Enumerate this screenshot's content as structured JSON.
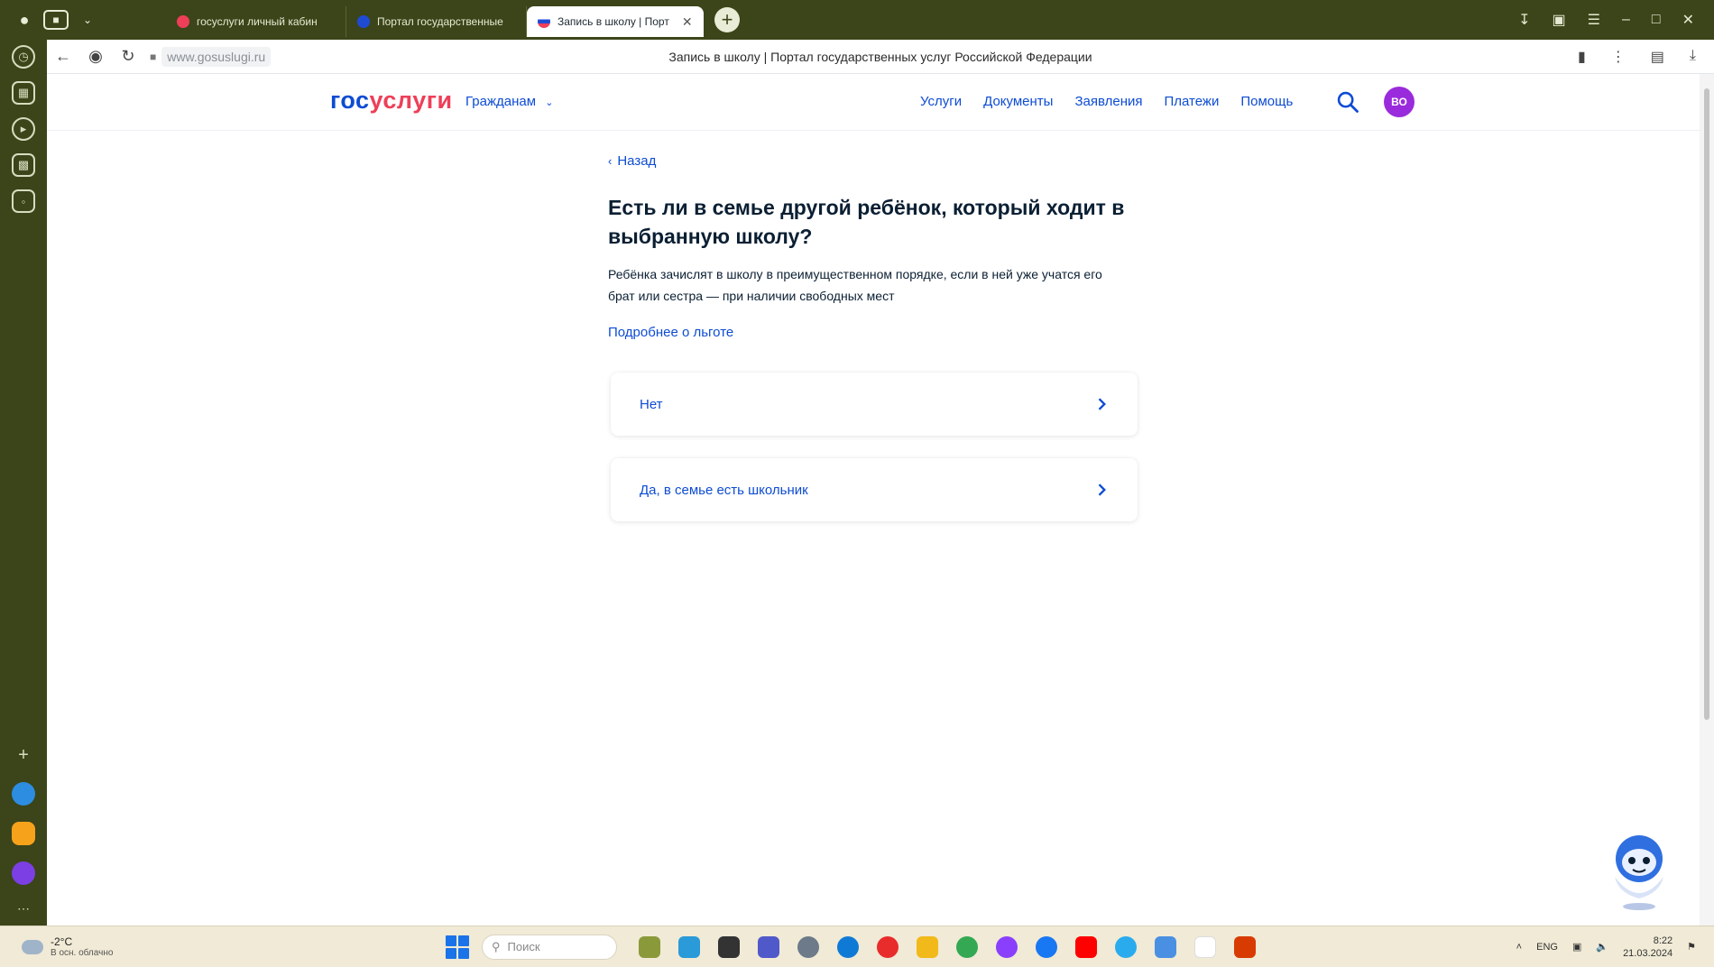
{
  "browser": {
    "tabs": [
      {
        "label": "госуслуги личный кабин",
        "color": "#ee3f58"
      },
      {
        "label": "Портал государственные",
        "color": "#1f4bd3"
      },
      {
        "label": "Запись в школу | Порт",
        "color": "#1f4bd3",
        "active": true
      }
    ],
    "url": "www.gosuslugi.ru",
    "page_title": "Запись в школу | Портал государственных услуг Российской Федерации"
  },
  "header": {
    "logo_part1": "гос",
    "logo_part2": "услуги",
    "citizens_menu": "Гражданам",
    "nav": [
      "Услуги",
      "Документы",
      "Заявления",
      "Платежи",
      "Помощь"
    ],
    "avatar_initials": "ВО"
  },
  "main": {
    "back_label": "Назад",
    "title": "Есть ли в семье другой ребёнок, который ходит в выбранную школу?",
    "description": "Ребёнка зачислят в школу в преимущественном порядке, если в ней уже учатся его брат или сестра — при наличии свободных мест",
    "more_link": "Подробнее о льготе",
    "options": [
      "Нет",
      "Да, в семье есть школьник"
    ]
  },
  "taskbar": {
    "temperature": "-2°C",
    "weather_text": "В осн. облачно",
    "search_placeholder": "Поиск",
    "language": "ENG",
    "time": "8:22",
    "date": "21.03.2024"
  },
  "colors": {
    "brand_blue": "#0d4cd3",
    "brand_red": "#ee3f58",
    "avatar": "#9a2bdc",
    "browser_frame": "#3b4519"
  }
}
